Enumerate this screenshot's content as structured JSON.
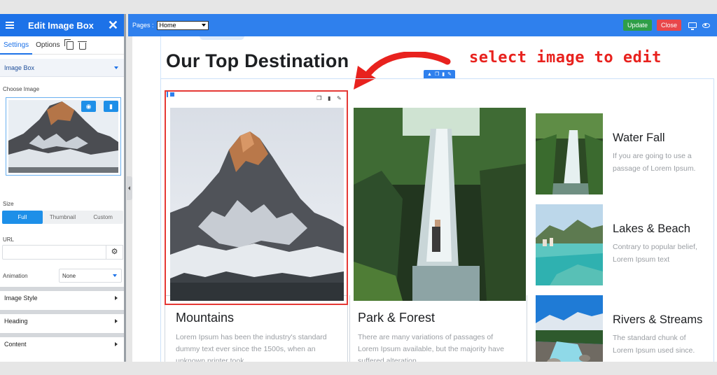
{
  "panel": {
    "title": "Edit Image Box",
    "tabs": {
      "settings": "Settings",
      "options": "Options"
    },
    "section": "Image Box",
    "choose_image_label": "Choose Image",
    "size_label": "Size",
    "size_options": {
      "full": "Full",
      "thumbnail": "Thumbnail",
      "custom": "Custom"
    },
    "size_selected": "Full",
    "url_label": "URL",
    "url_value": "",
    "animation_label": "Animation",
    "animation_value": "None",
    "collapsed_sections": {
      "image_style": "Image Style",
      "heading": "Heading",
      "content": "Content"
    }
  },
  "topbar": {
    "pages_label": "Pages :",
    "page_value": "Home",
    "update_label": "Update",
    "close_label": "Close"
  },
  "colors": {
    "brand_blue": "#2f80ed",
    "update_green": "#2e9e48",
    "close_red": "#e8474b",
    "annotation_red": "#e8221e"
  },
  "canvas": {
    "heading": "Our Top Destination",
    "annotation": "select image to edit",
    "cards": [
      {
        "title": "Mountains",
        "text": [
          "Lorem Ipsum has been the industry's standard",
          "dummy text ever since the 1500s, when an",
          "unknown printer took ."
        ]
      },
      {
        "title": "Park & Forest",
        "text": [
          "There are many variations of passages of",
          "Lorem Ipsum available, but the majority have",
          "suffered alteration."
        ]
      }
    ],
    "side_items": [
      {
        "title": "Water Fall",
        "text": [
          "If you are going to use a",
          "passage of Lorem Ipsum."
        ]
      },
      {
        "title": "Lakes & Beach",
        "text": [
          "Contrary to popular belief,",
          "Lorem Ipsum text"
        ]
      },
      {
        "title": "Rivers & Streams",
        "text": [
          "The standard chunk of",
          "Lorem Ipsum used since."
        ]
      }
    ]
  }
}
